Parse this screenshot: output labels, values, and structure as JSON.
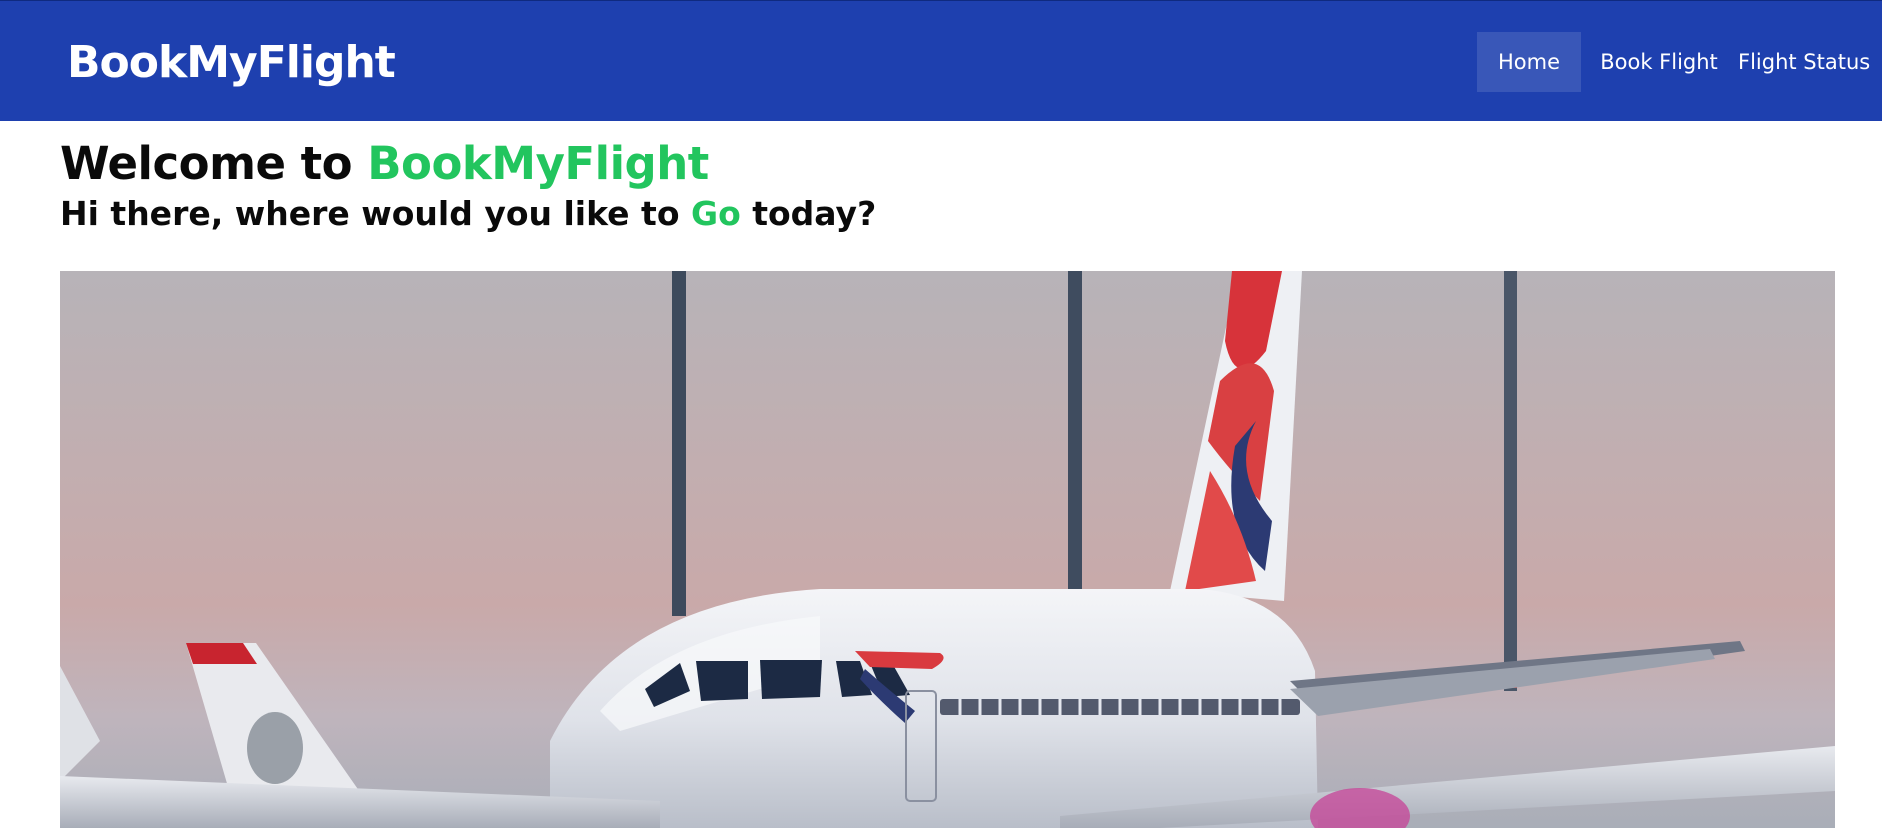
{
  "nav": {
    "brand": "BookMyFlight",
    "items": [
      {
        "label": "Home",
        "active": true
      },
      {
        "label": "Book Flight",
        "active": false
      },
      {
        "label": "Flight Status",
        "active": false
      }
    ]
  },
  "hero": {
    "welcome_prefix": "Welcome to ",
    "welcome_brand": "BookMyFlight",
    "sub_prefix": "Hi there, where would you like to ",
    "sub_highlight": "Go",
    "sub_suffix": " today?",
    "image_icon": "airplane-photo"
  },
  "colors": {
    "nav_bg": "#1e40af",
    "accent": "#22c55e",
    "text": "#0a0a0a"
  }
}
